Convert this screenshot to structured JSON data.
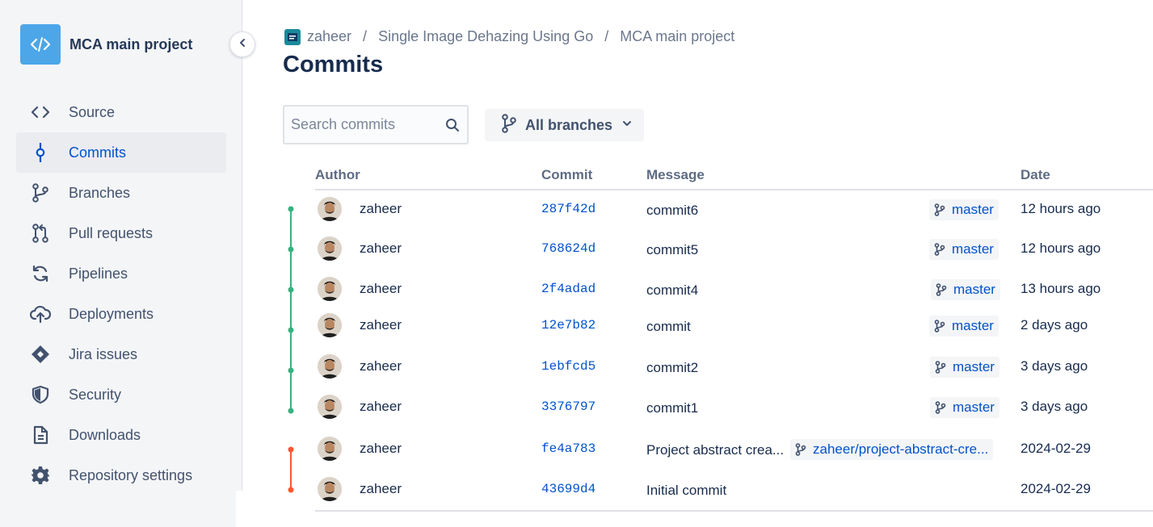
{
  "project": {
    "name": "MCA main project"
  },
  "sidebar": {
    "items": [
      {
        "label": "Source",
        "icon": "code-icon"
      },
      {
        "label": "Commits",
        "icon": "commit-icon",
        "active": true
      },
      {
        "label": "Branches",
        "icon": "branch-icon"
      },
      {
        "label": "Pull requests",
        "icon": "pull-request-icon"
      },
      {
        "label": "Pipelines",
        "icon": "pipelines-icon"
      },
      {
        "label": "Deployments",
        "icon": "cloud-upload-icon"
      },
      {
        "label": "Jira issues",
        "icon": "jira-icon"
      },
      {
        "label": "Security",
        "icon": "shield-icon"
      },
      {
        "label": "Downloads",
        "icon": "file-icon"
      },
      {
        "label": "Repository settings",
        "icon": "gear-icon"
      }
    ]
  },
  "breadcrumb": {
    "workspace": "zaheer",
    "project": "Single Image Dehazing Using Go",
    "repo": "MCA main project",
    "sep": "/"
  },
  "page": {
    "title": "Commits"
  },
  "search": {
    "placeholder": "Search commits"
  },
  "branch_filter": {
    "label": "All branches"
  },
  "table": {
    "headers": {
      "author": "Author",
      "commit": "Commit",
      "message": "Message",
      "date": "Date"
    },
    "rows": [
      {
        "author": "zaheer",
        "hash": "287f42d",
        "message": "commit6",
        "branch": "master",
        "date": "12 hours ago"
      },
      {
        "author": "zaheer",
        "hash": "768624d",
        "message": "commit5",
        "branch": "master",
        "date": "12 hours ago"
      },
      {
        "author": "zaheer",
        "hash": "2f4adad",
        "message": "commit4",
        "branch": "master",
        "date": "13 hours ago"
      },
      {
        "author": "zaheer",
        "hash": "12e7b82",
        "message": "commit",
        "branch": "master",
        "date": "2 days ago"
      },
      {
        "author": "zaheer",
        "hash": "1ebfcd5",
        "message": "commit2",
        "branch": "master",
        "date": "3 days ago"
      },
      {
        "author": "zaheer",
        "hash": "3376797",
        "message": "commit1",
        "branch": "master",
        "date": "3 days ago"
      },
      {
        "author": "zaheer",
        "hash": "fe4a783",
        "message": "Project abstract crea...",
        "branch": "zaheer/project-abstract-cre...",
        "date": "2024-02-29"
      },
      {
        "author": "zaheer",
        "hash": "43699d4",
        "message": "Initial commit",
        "branch": "",
        "date": "2024-02-29"
      }
    ]
  },
  "colors": {
    "graph_green": "#36b37e",
    "graph_orange": "#ff5630",
    "link": "#0052cc"
  }
}
